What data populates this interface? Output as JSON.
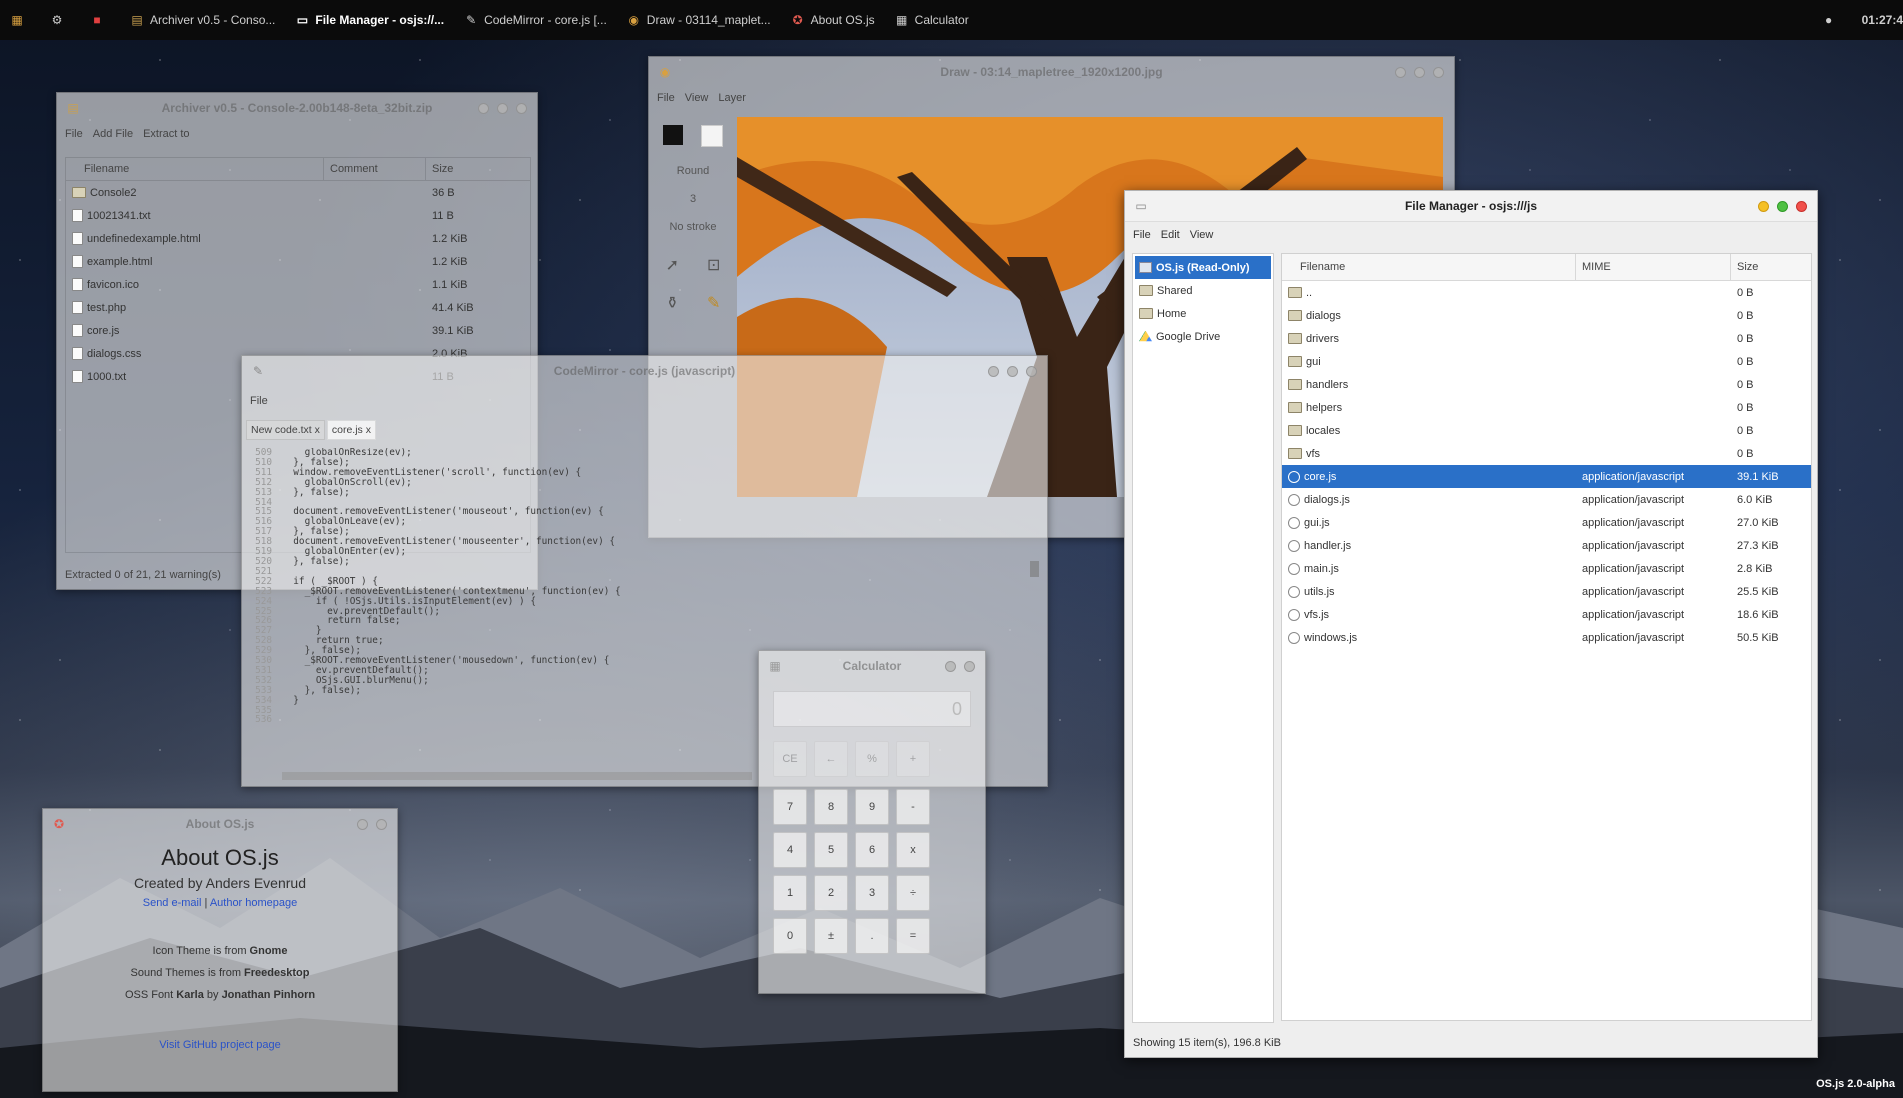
{
  "panel": {
    "clock": "01:27:4",
    "tasks": [
      {
        "label": "Archiver v0.5 - Conso...",
        "active": false
      },
      {
        "label": "File Manager - osjs://...",
        "active": true
      },
      {
        "label": "CodeMirror - core.js [...",
        "active": false
      },
      {
        "label": "Draw - 03114_maplet...",
        "active": false
      },
      {
        "label": "About OS.js",
        "active": false
      },
      {
        "label": "Calculator",
        "active": false
      }
    ]
  },
  "archiver": {
    "title": "Archiver v0.5 - Console-2.00b148-8eta_32bit.zip",
    "menu": [
      "File",
      "Add File",
      "Extract to"
    ],
    "columns": [
      "Filename",
      "Comment",
      "Size"
    ],
    "rows": [
      {
        "name": "Console2",
        "size": "36 B",
        "type": "folder"
      },
      {
        "name": "10021341.txt",
        "size": "11 B",
        "type": "file"
      },
      {
        "name": "undefinedexample.html",
        "size": "1.2 KiB",
        "type": "file"
      },
      {
        "name": "example.html",
        "size": "1.2 KiB",
        "type": "file"
      },
      {
        "name": "favicon.ico",
        "size": "1.1 KiB",
        "type": "file"
      },
      {
        "name": "test.php",
        "size": "41.4 KiB",
        "type": "file"
      },
      {
        "name": "core.js",
        "size": "39.1 KiB",
        "type": "file"
      },
      {
        "name": "dialogs.css",
        "size": "2.0 KiB",
        "type": "file"
      },
      {
        "name": "1000.txt",
        "size": "11 B",
        "type": "file"
      }
    ],
    "status": "Extracted 0 of 21, 21 warning(s)"
  },
  "draw": {
    "title": "Draw - 03:14_mapletree_1920x1200.jpg",
    "menu": [
      "File",
      "View",
      "Layer"
    ],
    "tool_labels": {
      "stroke_type": "Round",
      "stroke_width": "3",
      "stroke_mode": "No stroke"
    }
  },
  "codemirror": {
    "title": "CodeMirror - core.js (javascript)",
    "menu": [
      "File"
    ],
    "tabs": [
      {
        "label": "New code.txt",
        "close": "x"
      },
      {
        "label": "core.js",
        "close": "x"
      }
    ],
    "lines": [
      {
        "n": "509",
        "t": "    globalOnResize(ev);"
      },
      {
        "n": "510",
        "t": "  }, false);"
      },
      {
        "n": "511",
        "t": "  window.removeEventListener('scroll', function(ev) {"
      },
      {
        "n": "512",
        "t": "    globalOnScroll(ev);"
      },
      {
        "n": "513",
        "t": "  }, false);"
      },
      {
        "n": "514",
        "t": ""
      },
      {
        "n": "515",
        "t": "  document.removeEventListener('mouseout', function(ev) {"
      },
      {
        "n": "516",
        "t": "    globalOnLeave(ev);"
      },
      {
        "n": "517",
        "t": "  }, false);"
      },
      {
        "n": "518",
        "t": "  document.removeEventListener('mouseenter', function(ev) {"
      },
      {
        "n": "519",
        "t": "    globalOnEnter(ev);"
      },
      {
        "n": "520",
        "t": "  }, false);"
      },
      {
        "n": "521",
        "t": ""
      },
      {
        "n": "522",
        "t": "  if ( _$ROOT ) {"
      },
      {
        "n": "523",
        "t": "    _$ROOT.removeEventListener('contextmenu', function(ev) {"
      },
      {
        "n": "524",
        "t": "      if ( !OSjs.Utils.isInputElement(ev) ) {"
      },
      {
        "n": "525",
        "t": "        ev.preventDefault();"
      },
      {
        "n": "526",
        "t": "        return false;"
      },
      {
        "n": "527",
        "t": "      }"
      },
      {
        "n": "528",
        "t": "      return true;"
      },
      {
        "n": "529",
        "t": "    }, false);"
      },
      {
        "n": "530",
        "t": "    _$ROOT.removeEventListener('mousedown', function(ev) {"
      },
      {
        "n": "531",
        "t": "      ev.preventDefault();"
      },
      {
        "n": "532",
        "t": "      OSjs.GUI.blurMenu();"
      },
      {
        "n": "533",
        "t": "    }, false);"
      },
      {
        "n": "534",
        "t": "  }"
      },
      {
        "n": "535",
        "t": ""
      },
      {
        "n": "536",
        "t": ""
      }
    ]
  },
  "filemanager": {
    "title": "File Manager - osjs:///js",
    "menu": [
      "File",
      "Edit",
      "View"
    ],
    "sidebar": [
      {
        "label": "OS.js (Read-Only)",
        "selected": true,
        "icon": "drive-icon"
      },
      {
        "label": "Shared",
        "selected": false,
        "icon": "folder-icon"
      },
      {
        "label": "Home",
        "selected": false,
        "icon": "folder-icon"
      },
      {
        "label": "Google Drive",
        "selected": false,
        "icon": "google-drive-icon"
      }
    ],
    "columns": [
      "Filename",
      "MIME",
      "Size"
    ],
    "rows": [
      {
        "name": "..",
        "mime": "",
        "size": "0 B",
        "type": "folder",
        "selected": false
      },
      {
        "name": "dialogs",
        "mime": "",
        "size": "0 B",
        "type": "folder",
        "selected": false
      },
      {
        "name": "drivers",
        "mime": "",
        "size": "0 B",
        "type": "folder",
        "selected": false
      },
      {
        "name": "gui",
        "mime": "",
        "size": "0 B",
        "type": "folder",
        "selected": false
      },
      {
        "name": "handlers",
        "mime": "",
        "size": "0 B",
        "type": "folder",
        "selected": false
      },
      {
        "name": "helpers",
        "mime": "",
        "size": "0 B",
        "type": "folder",
        "selected": false
      },
      {
        "name": "locales",
        "mime": "",
        "size": "0 B",
        "type": "folder",
        "selected": false
      },
      {
        "name": "vfs",
        "mime": "",
        "size": "0 B",
        "type": "folder",
        "selected": false
      },
      {
        "name": "core.js",
        "mime": "application/javascript",
        "size": "39.1 KiB",
        "type": "js",
        "selected": true
      },
      {
        "name": "dialogs.js",
        "mime": "application/javascript",
        "size": "6.0 KiB",
        "type": "js",
        "selected": false
      },
      {
        "name": "gui.js",
        "mime": "application/javascript",
        "size": "27.0 KiB",
        "type": "js",
        "selected": false
      },
      {
        "name": "handler.js",
        "mime": "application/javascript",
        "size": "27.3 KiB",
        "type": "js",
        "selected": false
      },
      {
        "name": "main.js",
        "mime": "application/javascript",
        "size": "2.8 KiB",
        "type": "js",
        "selected": false
      },
      {
        "name": "utils.js",
        "mime": "application/javascript",
        "size": "25.5 KiB",
        "type": "js",
        "selected": false
      },
      {
        "name": "vfs.js",
        "mime": "application/javascript",
        "size": "18.6 KiB",
        "type": "js",
        "selected": false
      },
      {
        "name": "windows.js",
        "mime": "application/javascript",
        "size": "50.5 KiB",
        "type": "js",
        "selected": false
      }
    ],
    "status": "Showing 15 item(s), 196.8 KiB"
  },
  "calculator": {
    "title": "Calculator",
    "display": "0",
    "top_keys": [
      "CE",
      "←",
      "%",
      "+"
    ],
    "keys": [
      "7",
      "8",
      "9",
      "-",
      "4",
      "5",
      "6",
      "x",
      "1",
      "2",
      "3",
      "÷",
      "0",
      "±",
      ".",
      "="
    ]
  },
  "about": {
    "title": "About OS.js",
    "heading": "About OS.js",
    "created_by": "Created by Anders Evenrud",
    "send_email": "Send e-mail",
    "separator": "|",
    "author_homepage": "Author homepage",
    "credits": [
      {
        "prefix": "Icon Theme is from ",
        "name": "Gnome"
      },
      {
        "prefix": "Sound Themes is from ",
        "name": "Freedesktop"
      }
    ],
    "font_credit": {
      "prefix": "OSS Font ",
      "font": "Karla",
      "by": " by ",
      "author": "Jonathan Pinhorn"
    },
    "github_link": "Visit GitHub project page"
  },
  "desktop": {
    "watermark": "OS.js 2.0-alpha"
  },
  "colors": {
    "selection": "#2a70c8",
    "panel": "#0b0b0b",
    "link": "#2a52c8"
  }
}
